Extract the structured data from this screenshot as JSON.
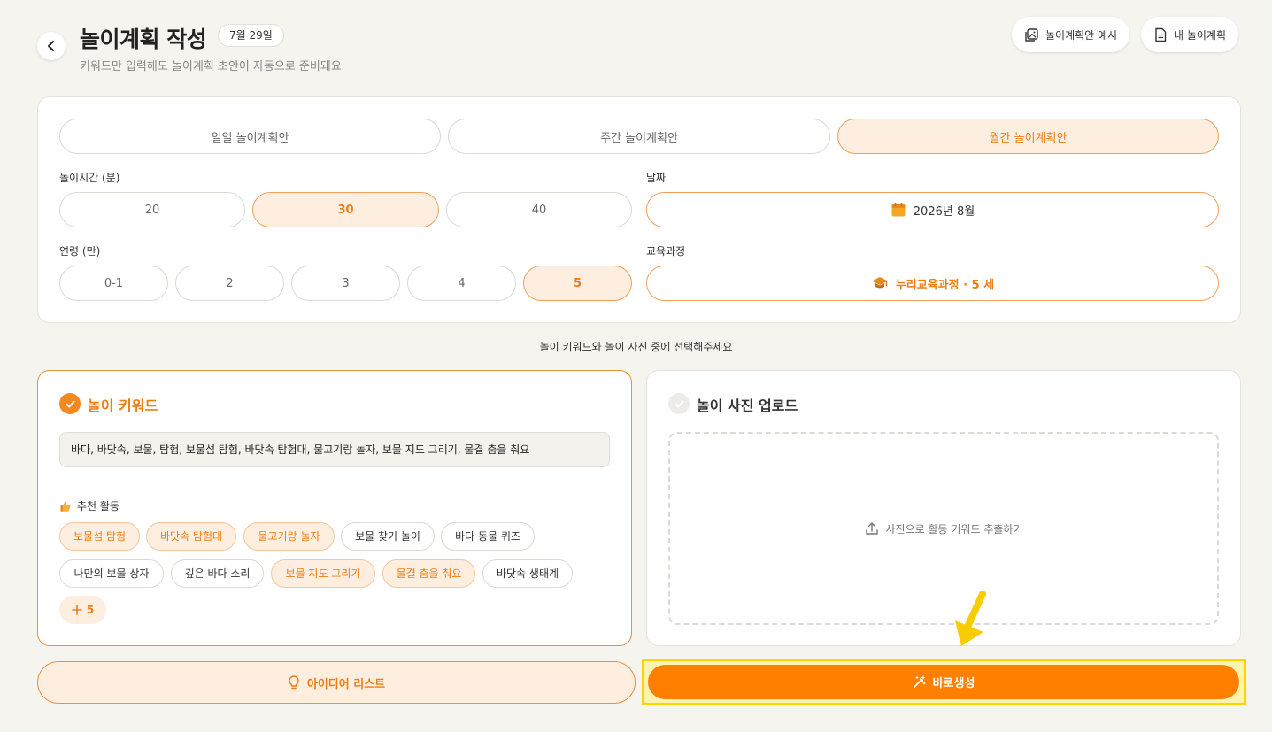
{
  "header": {
    "title": "놀이계획 작성",
    "date_badge": "7월 29일",
    "subtitle": "키워드만 입력해도 놀이계획 초안이 자동으로 준비돼요",
    "example_button": "놀이계획안 예시",
    "my_plans_button": "내 놀이계획"
  },
  "plan_types": [
    "일일 놀이계획안",
    "주간 놀이계획안",
    "월간 놀이계획안"
  ],
  "plan_type_selected": "월간 놀이계획안",
  "play_time": {
    "label": "놀이시간 (분)",
    "options": [
      "20",
      "30",
      "40"
    ],
    "selected": "30"
  },
  "date": {
    "label": "날짜",
    "value": "2026년 8월"
  },
  "age": {
    "label": "연령 (만)",
    "options": [
      "0-1",
      "2",
      "3",
      "4",
      "5"
    ],
    "selected": "5"
  },
  "curriculum": {
    "label": "교육과정",
    "value": "누리교육과정 · 5 세"
  },
  "choice_message": "놀이 키워드와 놀이 사진 중에 선택해주세요",
  "keyword_card": {
    "title": "놀이 키워드",
    "input_value": "바다, 바닷속, 보물, 탐험, 보물섬 탐험, 바닷속 탐험대, 물고기랑 놀자, 보물 지도 그리기, 물결 춤을 춰요",
    "recommend_title": "추천 활동",
    "chips": [
      {
        "label": "보물섬 탐험",
        "selected": true
      },
      {
        "label": "바닷속 탐험대",
        "selected": true
      },
      {
        "label": "물고기랑 놀자",
        "selected": true
      },
      {
        "label": "보물 찾기 놀이",
        "selected": false
      },
      {
        "label": "바다 동물 퀴즈",
        "selected": false
      },
      {
        "label": "나만의 보물 상자",
        "selected": false
      },
      {
        "label": "깊은 바다 소리",
        "selected": false
      },
      {
        "label": "보물 지도 그리기",
        "selected": true
      },
      {
        "label": "물결 춤을 춰요",
        "selected": true
      },
      {
        "label": "바닷속 생태계",
        "selected": false
      }
    ],
    "more_label": "5"
  },
  "upload_card": {
    "title": "놀이 사진 업로드",
    "dropzone_text": "사진으로 활동 키워드 추출하기"
  },
  "buttons": {
    "idea_list": "아이디어 리스트",
    "generate": "바로생성"
  },
  "colors": {
    "accent": "#ff7f00",
    "accent_light": "#fdeee0",
    "highlight": "#ffd400",
    "background": "#f6f4ee"
  }
}
